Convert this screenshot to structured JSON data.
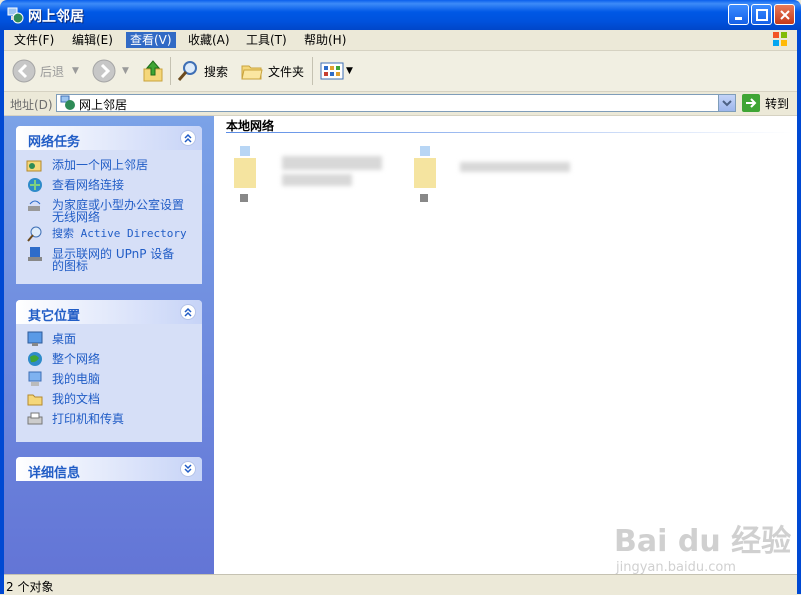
{
  "window": {
    "title": "网上邻居"
  },
  "menu": [
    {
      "label": "文件(F)"
    },
    {
      "label": "编辑(E)"
    },
    {
      "label": "查看(V)",
      "active": true
    },
    {
      "label": "收藏(A)"
    },
    {
      "label": "工具(T)"
    },
    {
      "label": "帮助(H)"
    }
  ],
  "toolbar": {
    "back_label": "后退",
    "search_label": "搜索",
    "folders_label": "文件夹"
  },
  "address": {
    "label": "地址(D)",
    "value": "网上邻居",
    "go_label": "转到"
  },
  "panels": {
    "network_tasks": {
      "title": "网络任务",
      "items": [
        {
          "label": "添加一个网上邻居",
          "icon": "add-network-place-icon"
        },
        {
          "label": "查看网络连接",
          "icon": "network-connections-icon"
        },
        {
          "label": "为家庭或小型办公室设置无线网络",
          "icon": "wireless-setup-icon"
        },
        {
          "label": "搜索 Active Directory",
          "icon": "search-directory-icon"
        },
        {
          "label": "显示联网的 UPnP 设备的图标",
          "icon": "upnp-device-icon"
        }
      ]
    },
    "other_places": {
      "title": "其它位置",
      "items": [
        {
          "label": "桌面",
          "icon": "desktop-icon"
        },
        {
          "label": "整个网络",
          "icon": "globe-icon"
        },
        {
          "label": "我的电脑",
          "icon": "my-computer-icon"
        },
        {
          "label": "我的文档",
          "icon": "my-documents-icon"
        },
        {
          "label": "打印机和传真",
          "icon": "printer-icon"
        }
      ]
    },
    "details": {
      "title": "详细信息"
    }
  },
  "content": {
    "group_title": "本地网络"
  },
  "status": {
    "text": "2 个对象"
  },
  "watermark": {
    "brand": "Bai du 经验",
    "url": "jingyan.baidu.com"
  },
  "colors": {
    "titlebar": "#0054E3",
    "taskpane": "#6F8FE0",
    "link": "#215DC6"
  }
}
